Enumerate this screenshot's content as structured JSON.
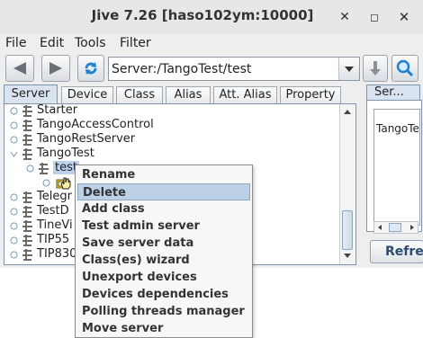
{
  "window": {
    "title": "Jive 7.26 [haso102ym:10000]",
    "controls": {
      "minimize": "✕",
      "maximize": "◻",
      "close": "✕"
    }
  },
  "menubar": [
    "File",
    "Edit",
    "Tools",
    "Filter"
  ],
  "toolbar": {
    "back_icon": "arrow-left-icon",
    "forward_icon": "arrow-right-icon",
    "refresh_icon": "refresh-icon",
    "path_value": "Server:/TangoTest/test",
    "download_icon": "download-icon",
    "search_icon": "search-icon"
  },
  "tabs": [
    "Server",
    "Device",
    "Class",
    "Alias",
    "Att. Alias",
    "Property"
  ],
  "active_tab": "Server",
  "tree": {
    "items": [
      "Starter",
      "TangoAccessControl",
      "TangoRestServer",
      "TangoTest",
      "test",
      "",
      "Telegr",
      "TestD",
      "TineVi",
      "TIP55",
      "TIP830"
    ]
  },
  "right_panel": {
    "tab_label": "Ser...",
    "list_item": "TangoTe",
    "refresh_label": "Refre"
  },
  "context_menu": {
    "items": [
      "Rename",
      "Delete",
      "Add class",
      "Test admin server",
      "Save server data",
      "Class(es) wizard",
      "Unexport devices",
      "Devices dependencies",
      "Polling threads manager",
      "Move server"
    ],
    "highlighted": "Delete"
  },
  "colors": {
    "selection": "#bcd0ea",
    "active_tab": "#d9e4f0",
    "accent_blue": "#1f7fd0"
  }
}
